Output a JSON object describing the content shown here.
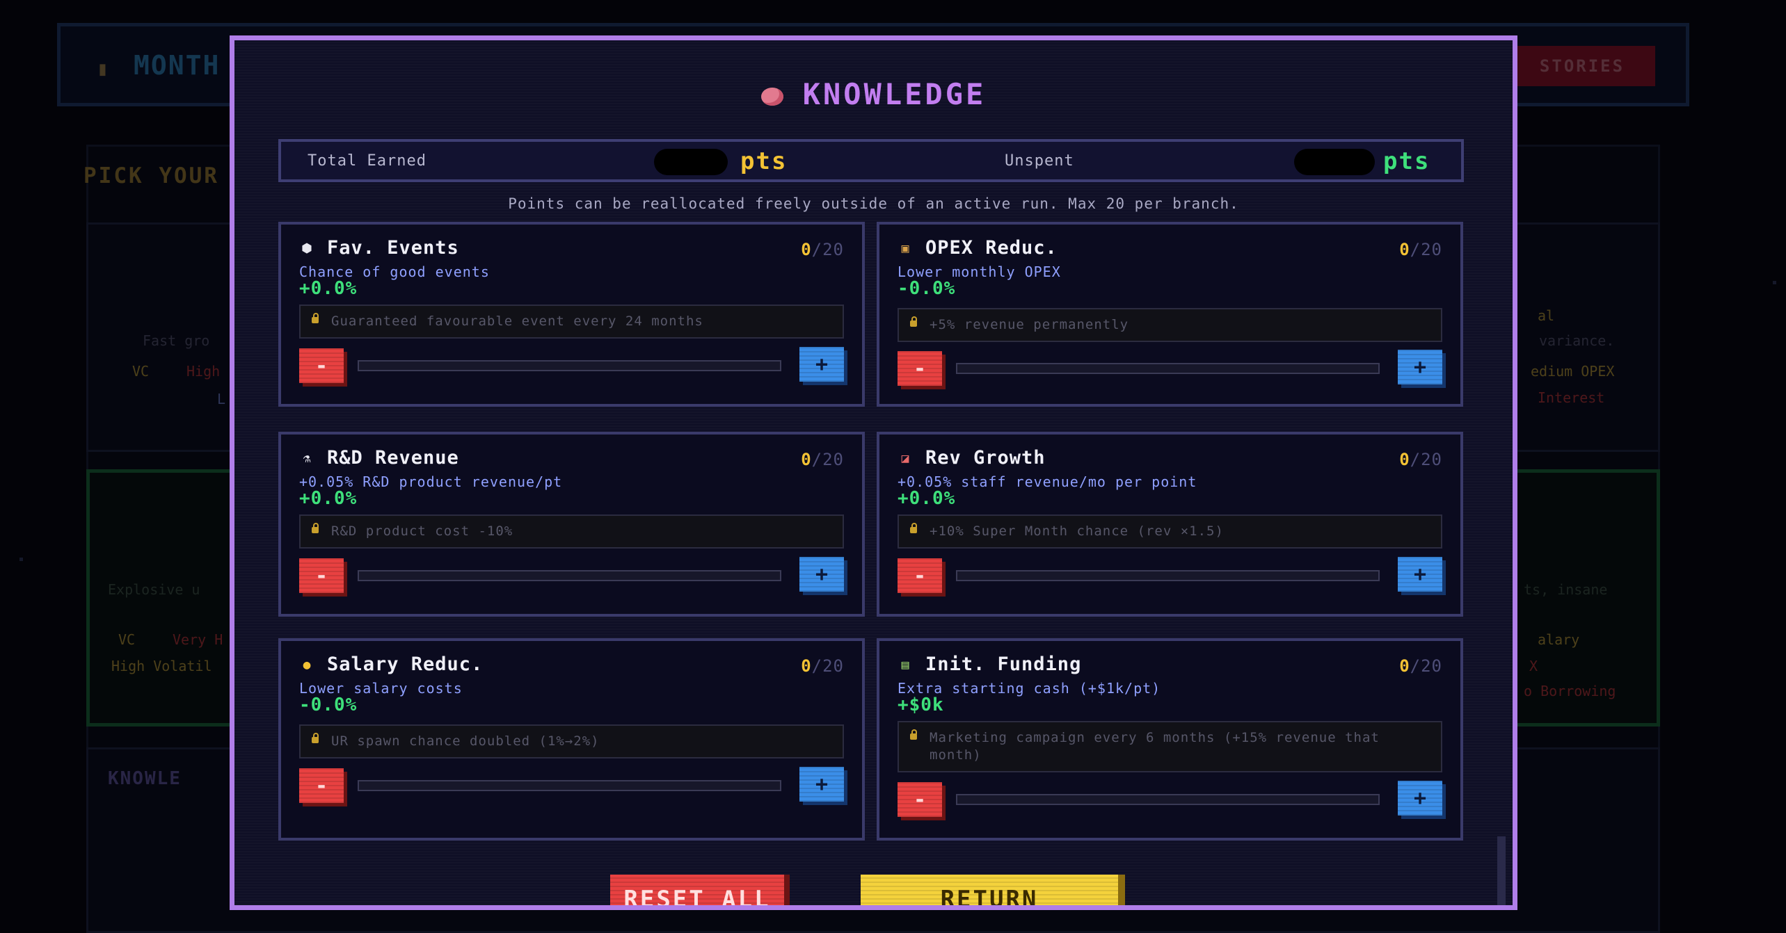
{
  "background": {
    "month_label": "MONTH",
    "stories_label": "STORIES",
    "pick_label": "PICK YOUR",
    "knowledge_label": "KNOWLE",
    "card1_lines": [
      "Fast gro",
      "VC",
      "High",
      "L"
    ],
    "card1_right_lines": [
      "al",
      "variance.",
      "edium OPEX",
      "Interest"
    ],
    "card2_lines": [
      "Explosive u",
      "VC",
      "Very H",
      "High Volatil"
    ],
    "card2_right_lines": [
      "ts, insane",
      "alary",
      "X",
      "o Borrowing"
    ]
  },
  "modal": {
    "title": "KNOWLEDGE",
    "totals": {
      "earned_label": "Total Earned",
      "earned_unit": "pts",
      "unspent_label": "Unspent",
      "unspent_unit": "pts"
    },
    "note": "Points can be reallocated freely outside of an active run. Max 20 per branch.",
    "branches": [
      {
        "icon": "dice-icon",
        "name": "Fav. Events",
        "current": "0",
        "separator": "/",
        "max": "20",
        "description": "Chance of good events",
        "value": "+0.0%",
        "perk": "Guaranteed favourable event every 24 months",
        "progress": 0
      },
      {
        "icon": "box-icon",
        "name": "OPEX Reduc.",
        "current": "0",
        "separator": "/",
        "max": "20",
        "description": "Lower monthly OPEX",
        "value": "-0.0%",
        "perk": "+5% revenue permanently",
        "progress": 0
      },
      {
        "icon": "flask-icon",
        "name": "R&D Revenue",
        "current": "0",
        "separator": "/",
        "max": "20",
        "description": "+0.05% R&D product revenue/pt",
        "value": "+0.0%",
        "perk": "R&D product cost -10%",
        "progress": 0
      },
      {
        "icon": "chart-up-icon",
        "name": "Rev Growth",
        "current": "0",
        "separator": "/",
        "max": "20",
        "description": "+0.05% staff revenue/mo per point",
        "value": "+0.0%",
        "perk": "+10% Super Month chance (rev ×1.5)",
        "progress": 0
      },
      {
        "icon": "money-bag-icon",
        "name": "Salary Reduc.",
        "current": "0",
        "separator": "/",
        "max": "20",
        "description": "Lower salary costs",
        "value": "-0.0%",
        "perk": "UR spawn chance doubled (1%→2%)",
        "progress": 0
      },
      {
        "icon": "banknote-icon",
        "name": "Init. Funding",
        "current": "0",
        "separator": "/",
        "max": "20",
        "description": "Extra starting cash (+$1k/pt)",
        "value": "+$0k",
        "perk": "Marketing campaign every 6 months (+15% revenue that month)",
        "progress": 0
      }
    ],
    "minus_label": "-",
    "plus_label": "+",
    "reset_label": "RESET ALL",
    "return_label": "RETURN"
  },
  "colors": {
    "modal_border": "#b07ee9",
    "title": "#c27ef0",
    "earned_pts": "#f3c234",
    "unspent_pts": "#3ee07b",
    "value_green": "#3ee07b",
    "count_current": "#f3c234",
    "minus_button": "#e84141",
    "plus_button": "#3b8ee8",
    "return_button": "#f4d23c"
  }
}
